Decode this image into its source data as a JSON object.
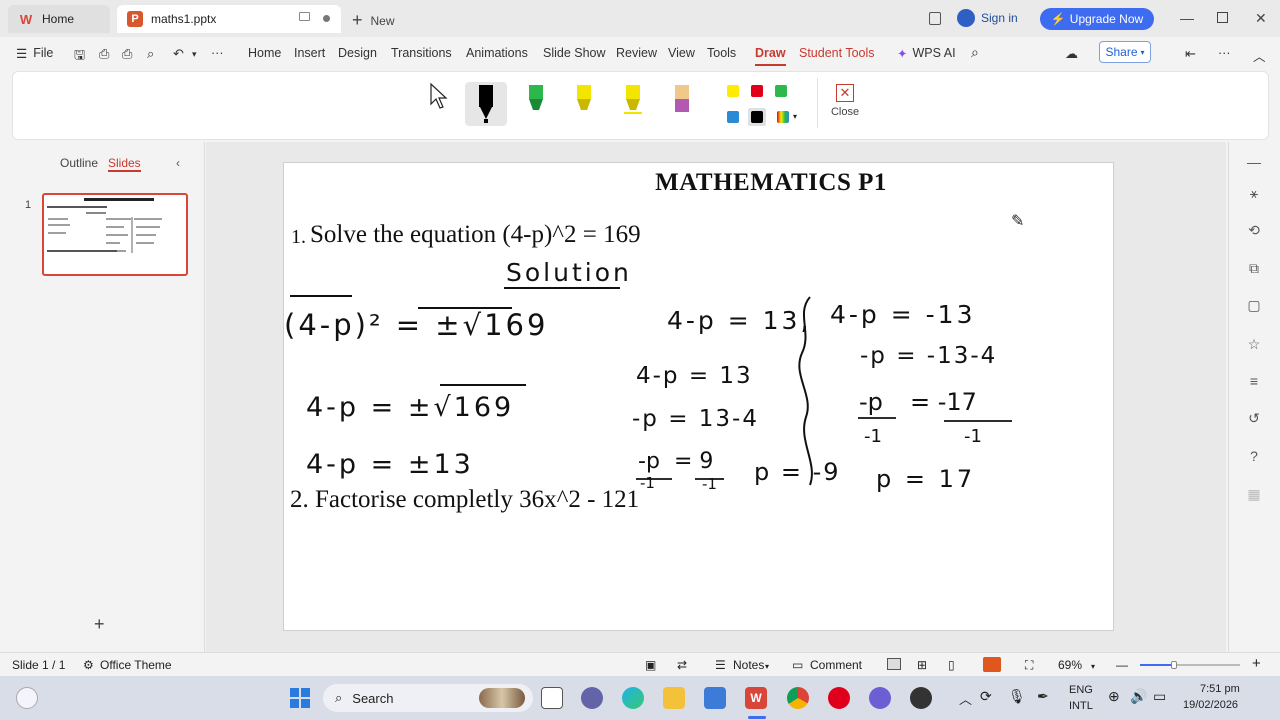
{
  "titlebar": {
    "home_tab": "Home",
    "doc_tab": "maths1.pptx",
    "new_tab": "New",
    "sign_in": "Sign in",
    "upgrade": "Upgrade Now"
  },
  "menu": {
    "file": "File",
    "items": [
      "Home",
      "Insert",
      "Design",
      "Transitions",
      "Animations",
      "Slide Show",
      "Review",
      "View",
      "Tools",
      "Draw",
      "Student Tools",
      "WPS AI"
    ],
    "active": "Draw",
    "share": "Share"
  },
  "ribbon": {
    "close_label": "Close",
    "pen_colors": [
      "#000000",
      "#2db84b",
      "#f2e600",
      "#f2e600",
      "#f0c98a"
    ],
    "swatches": [
      "#ffeb00",
      "#e0001b",
      "#2db84b",
      "#2a8ad4",
      "#000000"
    ]
  },
  "leftpanel": {
    "outline": "Outline",
    "slides": "Slides",
    "slide_number": "1"
  },
  "slide": {
    "title": "MATHEMATICS P1",
    "q1_number": "1.",
    "q1": "Solve the equation (4-p)^2 = 169",
    "q2": "2. Factorise completly 36x^2 - 121",
    "handwriting": {
      "heading": "Solution",
      "l1": "(4-p)² = ±√169",
      "l2": "4-p = ±√169",
      "l3": "4-p = ±13",
      "r1": "4-p = 13,",
      "r2": "4-p = 13",
      "r3": "-p = 13-4",
      "r4a": "-p",
      "r4b": "-1",
      "r4c": "= 9",
      "r4d": "-1",
      "r5": "p = -9",
      "s1": "4-p = -13",
      "s2": "-p = -13-4",
      "s3a": "-p",
      "s3b": "-1",
      "s3c": "= -17",
      "s3d": "-1",
      "s4": "p = 17"
    }
  },
  "status": {
    "slide_info": "Slide 1 / 1",
    "theme": "Office Theme",
    "notes": "Notes",
    "comment": "Comment",
    "zoom": "69%"
  },
  "taskbar": {
    "search": "Search",
    "lang1": "ENG",
    "lang2": "INTL",
    "time": "7:51 pm",
    "date": "19/02/2026"
  }
}
